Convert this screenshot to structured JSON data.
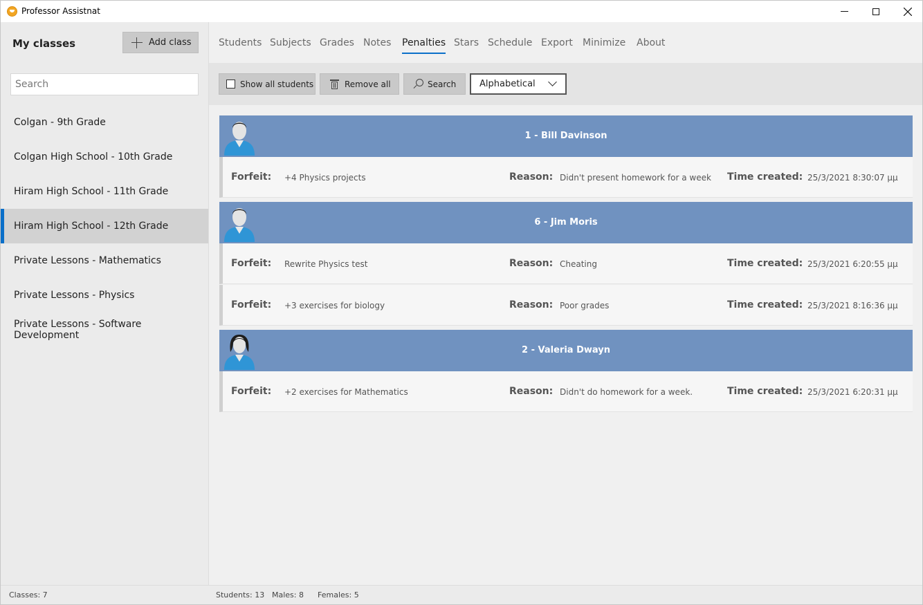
{
  "window": {
    "title": "Professor Assistnat"
  },
  "sidebar": {
    "heading": "My classes",
    "add_label": "Add class",
    "search_placeholder": "Search",
    "classes": [
      {
        "label": "Colgan - 9th Grade"
      },
      {
        "label": "Colgan High School - 10th Grade"
      },
      {
        "label": "Hiram High School - 11th Grade"
      },
      {
        "label": "Hiram High School - 12th Grade"
      },
      {
        "label": "Private Lessons - Mathematics"
      },
      {
        "label": "Private Lessons - Physics"
      },
      {
        "label": "Private Lessons - Software Development"
      }
    ],
    "selected_class": "Hiram High School - 12th Grade"
  },
  "tabs": [
    {
      "label": "Students"
    },
    {
      "label": "Subjects"
    },
    {
      "label": "Grades"
    },
    {
      "label": "Notes"
    },
    {
      "label": "Penalties"
    },
    {
      "label": "Stars"
    },
    {
      "label": "Schedule"
    },
    {
      "label": "Export"
    },
    {
      "label": "Minimize"
    },
    {
      "label": "About"
    }
  ],
  "active_tab": "Penalties",
  "toolbar": {
    "show_all_label": "Show all students",
    "show_all_checked": false,
    "remove_all_label": "Remove all",
    "search_label": "Search",
    "sort_value": "Alphabetical"
  },
  "labels": {
    "forfeit": "Forfeit:",
    "reason": "Reason:",
    "time_created": "Time created:"
  },
  "students": [
    {
      "name": "1 - Bill Davinson",
      "avatar": "male-student-icon",
      "penalties": [
        {
          "forfeit": "+4 Physics projects",
          "reason": "Didn't present homework for a week",
          "time": "25/3/2021 8:30:07 μμ"
        }
      ]
    },
    {
      "name": "6 - Jim Moris",
      "avatar": "male-student-icon",
      "penalties": [
        {
          "forfeit": "Rewrite Physics test",
          "reason": "Cheating",
          "time": "25/3/2021 6:20:55 μμ"
        },
        {
          "forfeit": "+3 exercises for biology",
          "reason": "Poor grades",
          "time": "25/3/2021 8:16:36 μμ"
        }
      ]
    },
    {
      "name": "2 - Valeria Dwayn",
      "avatar": "female-student-icon",
      "penalties": [
        {
          "forfeit": "+2 exercises for Mathematics",
          "reason": "Didn't do homework for a week.",
          "time": "25/3/2021 6:20:31 μμ"
        }
      ]
    }
  ],
  "status": {
    "classes": "Classes: 7",
    "students": "Students: 13",
    "males": "Males: 8",
    "females": "Females: 5"
  },
  "colors": {
    "accent": "#0a6fc9",
    "group_header": "#7092c0"
  }
}
